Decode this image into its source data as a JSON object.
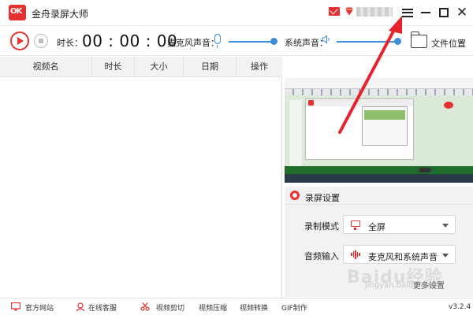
{
  "window": {
    "logo_text": "OK",
    "title": "金舟录屏大师",
    "close_glyph": "✕"
  },
  "toolbar": {
    "duration_label": "时长：",
    "duration_value": "00 : 00 : 00",
    "mic_label": "麦克风声音：",
    "system_label": "系统声音：",
    "folder_button": "文件位置",
    "mic_level_percent": 100,
    "system_level_percent": 100
  },
  "table": {
    "columns": [
      "视频名",
      "时长",
      "大小",
      "日期",
      "操作"
    ]
  },
  "settings": {
    "title": "录屏设置",
    "mode_label": "录制模式",
    "mode_value": "全屏",
    "audio_label": "音频输入",
    "audio_value": "麦克风和系统声音",
    "more_label": "更多设置"
  },
  "footer": {
    "items": [
      "官方网站",
      "在线客服",
      "视频剪切",
      "视频压缩",
      "视频转换",
      "GIF制作"
    ],
    "version": "v3.2.4"
  },
  "watermark": {
    "main": "Baidu经验",
    "sub": "jingyan.baidu.com"
  },
  "colors": {
    "accent": "#e5312f",
    "slider": "#3b8cd9",
    "annotation_arrow": "#e8222a"
  }
}
